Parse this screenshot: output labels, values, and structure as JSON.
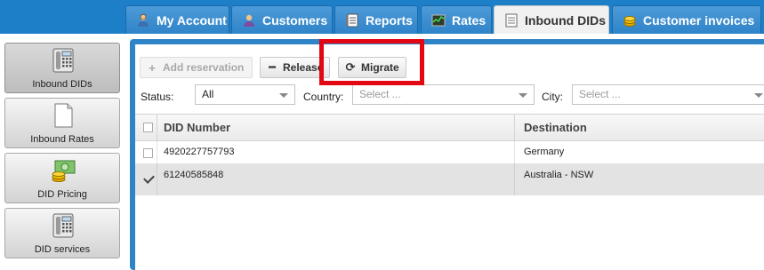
{
  "tabs": [
    {
      "label": "My Account",
      "icon": "user-icon",
      "active": false
    },
    {
      "label": "Customers",
      "icon": "customer-icon",
      "active": false
    },
    {
      "label": "Reports",
      "icon": "reports-icon",
      "active": false
    },
    {
      "label": "Rates",
      "icon": "rates-icon",
      "active": false
    },
    {
      "label": "Inbound DIDs",
      "icon": "document-icon",
      "active": true
    },
    {
      "label": "Customer invoices",
      "icon": "coins-icon",
      "active": false
    }
  ],
  "sidebar": {
    "items": [
      {
        "label": "Inbound DIDs",
        "icon": "phone-icon",
        "active": true
      },
      {
        "label": "Inbound Rates",
        "icon": "blank-page-icon",
        "active": false
      },
      {
        "label": "DID Pricing",
        "icon": "money-icon",
        "active": false
      },
      {
        "label": "DID services",
        "icon": "phone-icon",
        "active": false
      }
    ]
  },
  "toolbar": {
    "add_reservation": "Add reservation",
    "release": "Release",
    "migrate": "Migrate"
  },
  "filters": {
    "status_label": "Status:",
    "status_value": "All",
    "country_label": "Country:",
    "country_placeholder": "Select ...",
    "city_label": "City:",
    "city_placeholder": "Select ..."
  },
  "grid": {
    "columns": [
      "DID Number",
      "Destination"
    ],
    "rows": [
      {
        "did": "4920227757793",
        "destination": "Germany",
        "checked": false
      },
      {
        "did": "61240585848",
        "destination": "Australia - NSW",
        "checked": true
      }
    ]
  },
  "colors": {
    "accent": "#2f84c8",
    "highlight": "#e30613"
  }
}
